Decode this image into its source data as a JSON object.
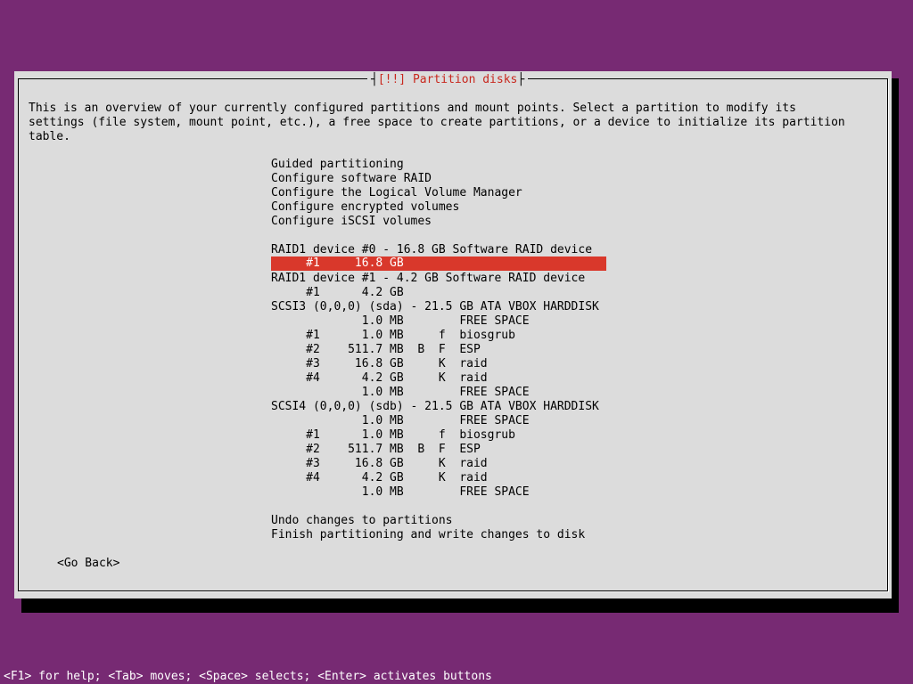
{
  "dialog": {
    "title_left": "[!!] ",
    "title": "Partition disks",
    "intro_lines": [
      "This is an overview of your currently configured partitions and mount points. Select a partition to modify its",
      "settings (file system, mount point, etc.), a free space to create partitions, or a device to initialize its partition",
      "table."
    ]
  },
  "menu": {
    "actions": [
      "Guided partitioning",
      "Configure software RAID",
      "Configure the Logical Volume Manager",
      "Configure encrypted volumes",
      "Configure iSCSI volumes"
    ],
    "entries": [
      "RAID1 device #0 - 16.8 GB Software RAID device",
      "     #1     16.8 GB",
      "RAID1 device #1 - 4.2 GB Software RAID device",
      "     #1      4.2 GB",
      "SCSI3 (0,0,0) (sda) - 21.5 GB ATA VBOX HARDDISK",
      "             1.0 MB        FREE SPACE",
      "     #1      1.0 MB     f  biosgrub",
      "     #2    511.7 MB  B  F  ESP",
      "     #3     16.8 GB     K  raid",
      "     #4      4.2 GB     K  raid",
      "             1.0 MB        FREE SPACE",
      "SCSI4 (0,0,0) (sdb) - 21.5 GB ATA VBOX HARDDISK",
      "             1.0 MB        FREE SPACE",
      "     #1      1.0 MB     f  biosgrub",
      "     #2    511.7 MB  B  F  ESP",
      "     #3     16.8 GB     K  raid",
      "     #4      4.2 GB     K  raid",
      "             1.0 MB        FREE SPACE"
    ],
    "selected_index": 1,
    "footer_actions": [
      "Undo changes to partitions",
      "Finish partitioning and write changes to disk"
    ]
  },
  "buttons": {
    "go_back": "<Go Back>"
  },
  "help_line": "<F1> for help; <Tab> moves; <Space> selects; <Enter> activates buttons",
  "colors": {
    "background": "#772a73",
    "dialog": "#dcdcdc",
    "highlight": "#d9382b",
    "title": "#c8281e"
  }
}
